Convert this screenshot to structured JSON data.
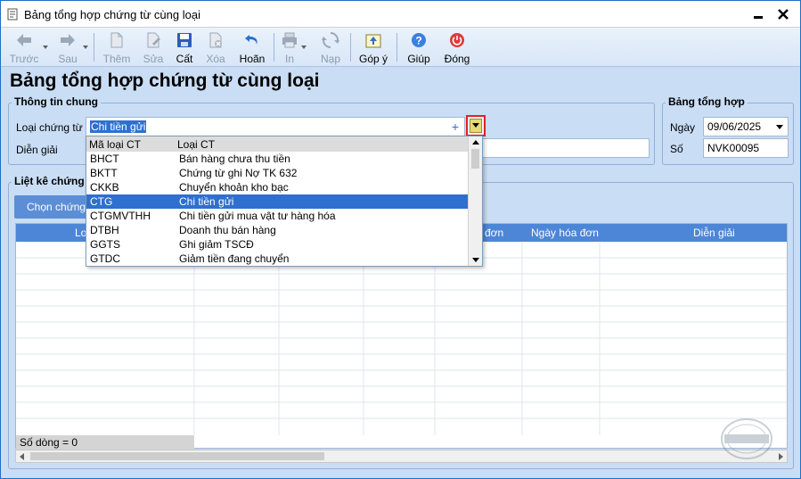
{
  "window": {
    "title": "Bảng tổng hợp chứng từ cùng loại"
  },
  "toolbar": {
    "prev": "Trước",
    "next": "Sau",
    "add": "Thêm",
    "edit": "Sửa",
    "cut": "Cất",
    "delete": "Xóa",
    "undo": "Hoãn",
    "print": "In",
    "load": "Nạp",
    "feedback": "Góp ý",
    "help": "Giúp",
    "close": "Đóng"
  },
  "page": {
    "title": "Bảng tổng hợp chứng từ cùng loại"
  },
  "general": {
    "group_title": "Thông tin chung",
    "doc_type_label": "Loại chứng từ",
    "doc_type_value": "Chi tiền gửi",
    "description_label": "Diễn giải",
    "description_value": ""
  },
  "summary": {
    "group_title": "Bảng tổng hợp",
    "date_label": "Ngày",
    "date_value": "09/06/2025",
    "number_label": "Số",
    "number_value": "NVK00095"
  },
  "list": {
    "group_title": "Liệt kê chứng t",
    "choose_button": "Chọn chứng t",
    "columns": [
      "Lo",
      "đơn",
      "Ngày hóa đơn",
      "Diễn giải"
    ],
    "row_count": "Số dòng = 0"
  },
  "dropdown": {
    "col_code": "Mã loại CT",
    "col_name": "Loại CT",
    "items": [
      {
        "code": "BHCT",
        "name": "Bán hàng chưa thu tiền"
      },
      {
        "code": "BKTT",
        "name": "Chứng từ ghi Nợ TK 632"
      },
      {
        "code": "CKKB",
        "name": "Chuyển khoản kho bạc"
      },
      {
        "code": "CTG",
        "name": "Chi tiền gửi"
      },
      {
        "code": "CTGMVTHH",
        "name": "Chi tiền gửi mua vật tư hàng hóa"
      },
      {
        "code": "DTBH",
        "name": "Doanh thu bán hàng"
      },
      {
        "code": "GGTS",
        "name": "Ghi giảm TSCĐ"
      },
      {
        "code": "GTDC",
        "name": "Giảm tiền đang chuyển"
      }
    ],
    "selected_index": 3
  }
}
